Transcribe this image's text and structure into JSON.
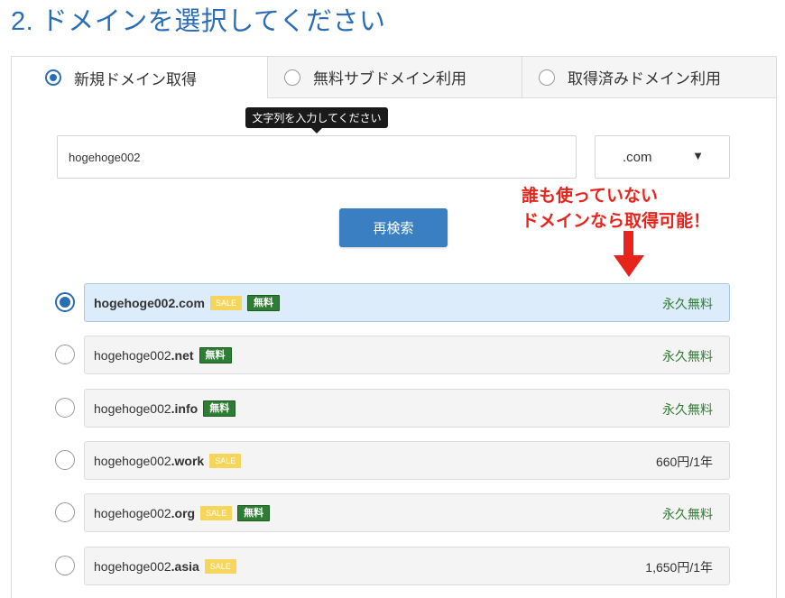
{
  "section_title": "2. ドメインを選択してください",
  "tabs": [
    {
      "label": "新規ドメイン取得",
      "selected": true
    },
    {
      "label": "無料サブドメイン利用",
      "selected": false
    },
    {
      "label": "取得済みドメイン利用",
      "selected": false
    }
  ],
  "search": {
    "tooltip": "文字列を入力してください",
    "value": "hogehoge002",
    "tld_selected": ".com",
    "tld_arrow": "▼",
    "button_label": "再検索"
  },
  "annotation": {
    "line1": "誰も使っていない",
    "line2": "ドメインなら取得可能！",
    "color": "#e8231b"
  },
  "results": [
    {
      "name": "hogehoge002",
      "tld": ".com",
      "sale": "SALE",
      "free": "無料",
      "price": "永久無料",
      "price_type": "free",
      "selected": true
    },
    {
      "name": "hogehoge002",
      "tld": ".net",
      "sale": "",
      "free": "無料",
      "price": "永久無料",
      "price_type": "free",
      "selected": false
    },
    {
      "name": "hogehoge002",
      "tld": ".info",
      "sale": "",
      "free": "無料",
      "price": "永久無料",
      "price_type": "free",
      "selected": false
    },
    {
      "name": "hogehoge002",
      "tld": ".work",
      "sale": "SALE",
      "free": "",
      "price": "660円/1年",
      "price_type": "paid",
      "selected": false
    },
    {
      "name": "hogehoge002",
      "tld": ".org",
      "sale": "SALE",
      "free": "無料",
      "price": "永久無料",
      "price_type": "free",
      "selected": false
    },
    {
      "name": "hogehoge002",
      "tld": ".asia",
      "sale": "SALE",
      "free": "",
      "price": "1,650円/1年",
      "price_type": "paid",
      "selected": false
    }
  ],
  "colors": {
    "title": "#2b6db4",
    "button": "#3a7fc2",
    "free_badge": "#2e7d32",
    "sale_badge": "#f5d55a",
    "selected_row": "#dcecfa"
  }
}
